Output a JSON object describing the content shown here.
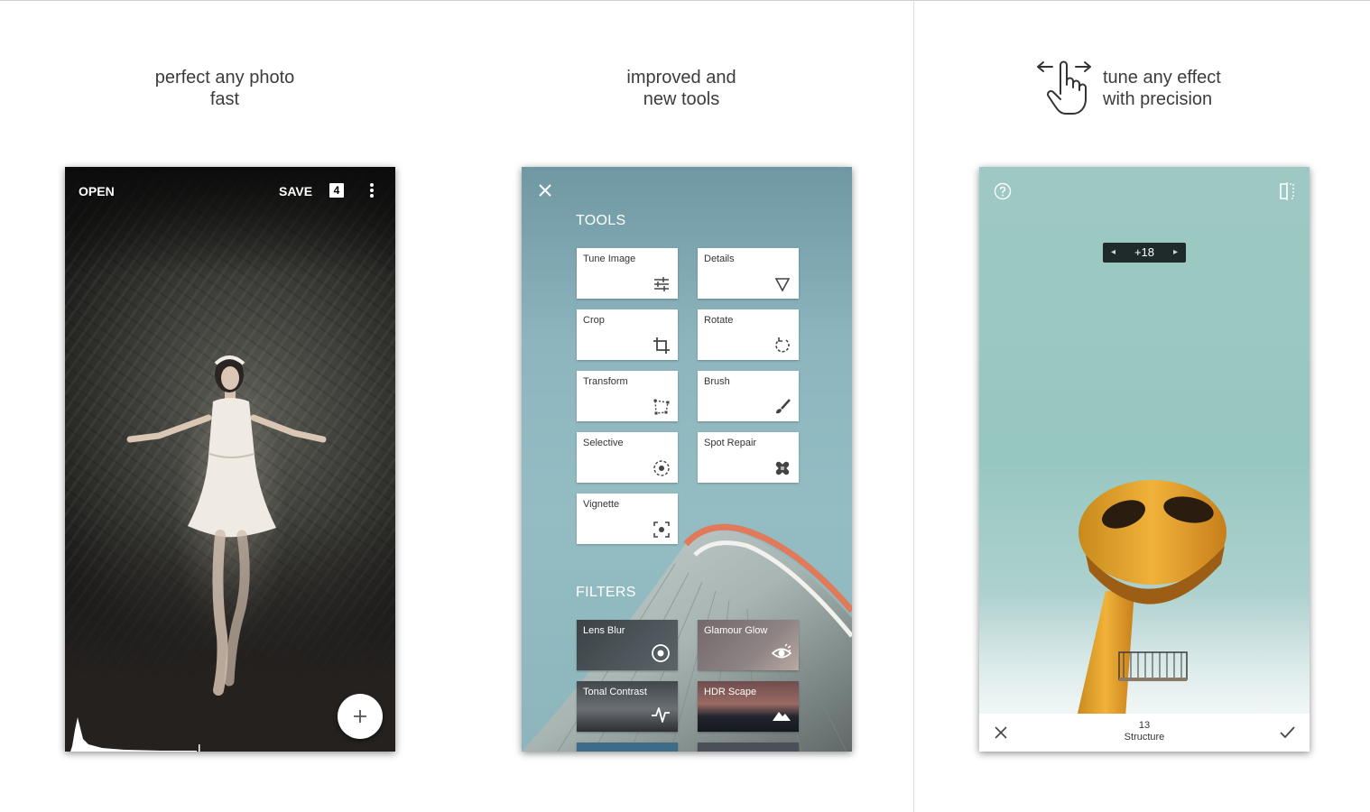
{
  "captions": {
    "left": [
      "perfect any photo",
      "fast"
    ],
    "middle": [
      "improved and",
      "new tools"
    ],
    "right": [
      "tune any effect",
      "with precision"
    ]
  },
  "phone1": {
    "open_label": "OPEN",
    "save_label": "SAVE",
    "badge": "4",
    "fab_icon": "plus-icon"
  },
  "phone2": {
    "tools_title": "TOOLS",
    "tools": [
      {
        "label": "Tune Image",
        "icon": "sliders-icon"
      },
      {
        "label": "Details",
        "icon": "triangle-down-icon"
      },
      {
        "label": "Crop",
        "icon": "crop-icon"
      },
      {
        "label": "Rotate",
        "icon": "rotate-icon"
      },
      {
        "label": "Transform",
        "icon": "transform-icon"
      },
      {
        "label": "Brush",
        "icon": "brush-icon"
      },
      {
        "label": "Selective",
        "icon": "selective-icon"
      },
      {
        "label": "Spot Repair",
        "icon": "bandage-icon"
      },
      {
        "label": "Vignette",
        "icon": "vignette-icon"
      }
    ],
    "filters_title": "FILTERS",
    "filters": [
      {
        "label": "Lens Blur",
        "icon": "target-icon"
      },
      {
        "label": "Glamour Glow",
        "icon": "eye-icon"
      },
      {
        "label": "Tonal Contrast",
        "icon": "pulse-icon"
      },
      {
        "label": "HDR Scape",
        "icon": "mountain-icon"
      }
    ]
  },
  "phone3": {
    "adjust_value": "+18",
    "value": "13",
    "param_name": "Structure"
  },
  "colors": {
    "teal_sky": "#97c7c1",
    "tool_tile_bg": "#ffffff",
    "dark_pill": "#1f2b2b"
  }
}
